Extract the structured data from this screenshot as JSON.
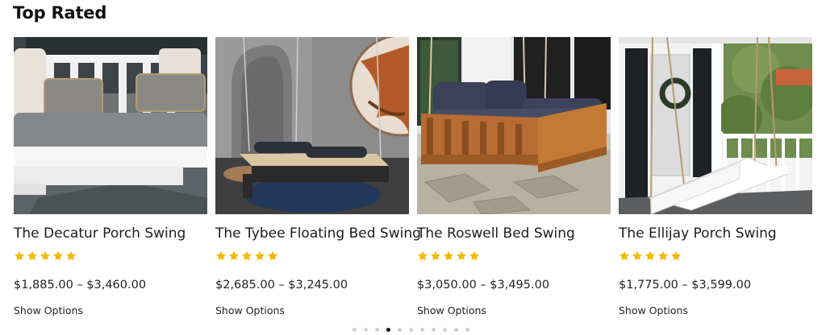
{
  "section": {
    "title": "Top Rated"
  },
  "colors": {
    "star": "#f5b800",
    "dot": "#d0d0d0",
    "dot_active": "#111111"
  },
  "products": [
    {
      "name": "The Decatur Porch Swing",
      "rating": 5,
      "price": "$1,885.00 – $3,460.00",
      "cta": "Show Options",
      "image_icon": "porch-swing-photo"
    },
    {
      "name": "The Tybee Floating Bed Swing",
      "rating": 5,
      "price": "$2,685.00 – $3,245.00",
      "cta": "Show Options",
      "image_icon": "floating-bed-swing-photo"
    },
    {
      "name": "The Roswell Bed Swing",
      "rating": 5,
      "price": "$3,050.00 – $3,495.00",
      "cta": "Show Options",
      "image_icon": "bed-swing-photo"
    },
    {
      "name": "The Ellijay Porch Swing",
      "rating": 5,
      "price": "$1,775.00 – $3,599.00",
      "cta": "Show Options",
      "image_icon": "porch-swing-photo"
    }
  ],
  "pagination": {
    "total": 11,
    "active_index": 3
  }
}
